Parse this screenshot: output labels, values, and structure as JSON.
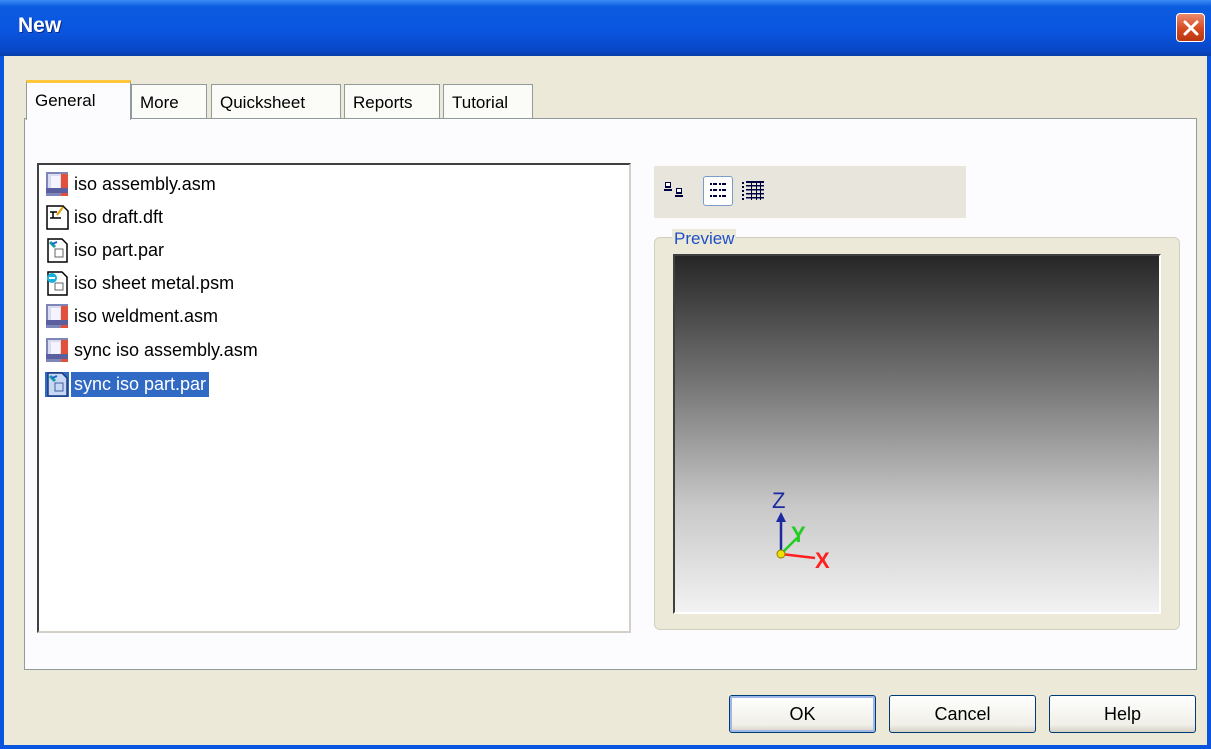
{
  "window": {
    "title": "New"
  },
  "tabs": [
    {
      "label": "General",
      "active": true
    },
    {
      "label": "More",
      "active": false
    },
    {
      "label": "Quicksheet",
      "active": false
    },
    {
      "label": "Reports",
      "active": false
    },
    {
      "label": "Tutorial",
      "active": false
    }
  ],
  "files": [
    {
      "name": "iso assembly.asm",
      "icon": "assembly-file-icon",
      "selected": false
    },
    {
      "name": "iso draft.dft",
      "icon": "draft-file-icon",
      "selected": false
    },
    {
      "name": "iso part.par",
      "icon": "part-file-icon",
      "selected": false
    },
    {
      "name": "iso sheet metal.psm",
      "icon": "sheet-metal-file-icon",
      "selected": false
    },
    {
      "name": "iso weldment.asm",
      "icon": "assembly-file-icon",
      "selected": false
    },
    {
      "name": "sync iso assembly.asm",
      "icon": "assembly-file-icon",
      "selected": false
    },
    {
      "name": "sync iso part.par",
      "icon": "part-file-icon",
      "selected": true
    }
  ],
  "view_modes": [
    {
      "name": "large-icons",
      "pressed": false
    },
    {
      "name": "list",
      "pressed": true
    },
    {
      "name": "details",
      "pressed": false
    }
  ],
  "preview": {
    "label": "Preview",
    "axes": {
      "z": "Z",
      "y": "Y",
      "x": "X"
    }
  },
  "buttons": {
    "ok": "OK",
    "cancel": "Cancel",
    "help": "Help"
  },
  "colors": {
    "titlebar": "#0a55e0",
    "selection": "#316ac5",
    "tab_highlight": "#ffc83c",
    "axis_x": "#ff2020",
    "axis_y": "#22cc22",
    "axis_z": "#1a2aa0"
  }
}
